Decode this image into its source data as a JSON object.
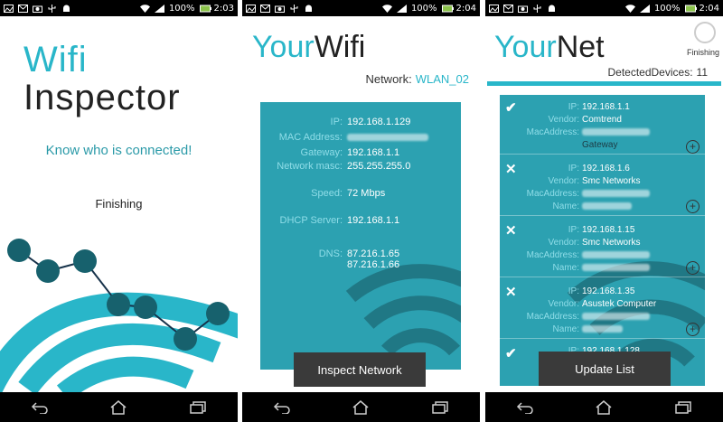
{
  "status": {
    "battery": "100%",
    "times": [
      "2:03",
      "2:04",
      "2:04"
    ]
  },
  "screen1": {
    "title_line1": "Wifi",
    "title_line2": "Inspector",
    "tagline": "Know who is connected!",
    "status": "Finishing"
  },
  "screen2": {
    "title_part1": "Your",
    "title_part2": "Wifi",
    "network_label": "Network:",
    "network_value": "WLAN_02",
    "info": [
      {
        "label": "IP:",
        "value": "192.168.1.129"
      },
      {
        "label": "MAC Address:",
        "value": ""
      },
      {
        "label": "Gateway:",
        "value": "192.168.1.1"
      },
      {
        "label": "Network masc:",
        "value": "255.255.255.0"
      },
      {
        "label": "Speed:",
        "value": "72 Mbps"
      },
      {
        "label": "DHCP Server:",
        "value": "192.168.1.1"
      },
      {
        "label": "DNS:",
        "value": "87.216.1.65"
      },
      {
        "label": "",
        "value": "87.216.1.66"
      }
    ],
    "button": "Inspect Network"
  },
  "screen3": {
    "title_part1": "Your",
    "title_part2": "Net",
    "spinner_label": "Finishing",
    "detected_label": "DetectedDevices:",
    "detected_count": "11",
    "devices": [
      {
        "mark": "✔",
        "ip": "192.168.1.1",
        "vendor": "Comtrend",
        "mac": "",
        "name": "Gateway"
      },
      {
        "mark": "✕",
        "ip": "192.168.1.6",
        "vendor": "Smc Networks",
        "mac": "",
        "name": ""
      },
      {
        "mark": "✕",
        "ip": "192.168.1.15",
        "vendor": "Smc Networks",
        "mac": "",
        "name": ""
      },
      {
        "mark": "✕",
        "ip": "192.168.1.35",
        "vendor": "Asustek Computer",
        "mac": "",
        "name": ""
      },
      {
        "mark": "✔",
        "ip": "192.168.1.128",
        "vendor": "",
        "mac": "",
        "name": ""
      }
    ],
    "labels": {
      "ip": "IP:",
      "vendor": "Vendor:",
      "mac": "MacAddress:",
      "name": "Name:"
    },
    "button": "Update List"
  },
  "colors": {
    "accent": "#29b6c9",
    "panel": "#2ca1b1",
    "button": "#3a3a3a"
  }
}
